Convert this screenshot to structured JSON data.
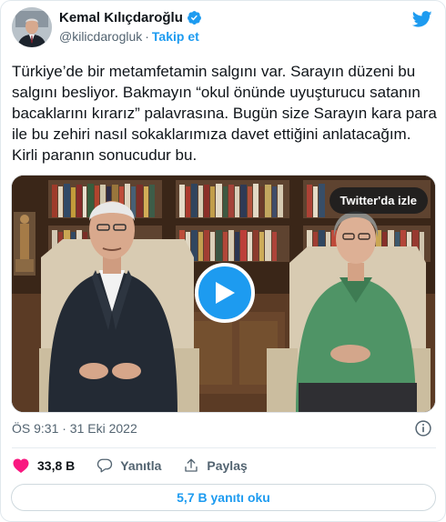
{
  "author": {
    "name": "Kemal Kılıçdaroğlu",
    "handle": "@kilicdarogluk",
    "separator": "·",
    "follow_label": "Takip et"
  },
  "tweet": {
    "text": "Türkiye’de bir metamfetamin salgını var. Sarayın düzeni bu salgını besliyor. Bakmayın “okul önünde uyuşturucu satanın bacaklarını kırarız” palavrasına. Bugün size Sarayın kara para ile bu zehiri nasıl sokaklarımıza davet ettiğini anlatacağım. Kirli paranın sonucudur bu."
  },
  "video": {
    "watch_label": "Twitter'da izle"
  },
  "meta": {
    "timestamp": "ÖS 9:31 · 31 Eki 2022"
  },
  "actions": {
    "like_count": "33,8 B",
    "reply_label": "Yanıtla",
    "share_label": "Paylaş"
  },
  "replies_button": {
    "label": "5,7 B yanıtı oku"
  },
  "colors": {
    "accent": "#1d9bf0",
    "like": "#f91880",
    "text": "#0f1419",
    "secondary": "#536471"
  },
  "icons": [
    "verified-badge-icon",
    "twitter-bird-icon",
    "play-icon",
    "info-icon",
    "heart-icon",
    "reply-icon",
    "share-icon"
  ]
}
